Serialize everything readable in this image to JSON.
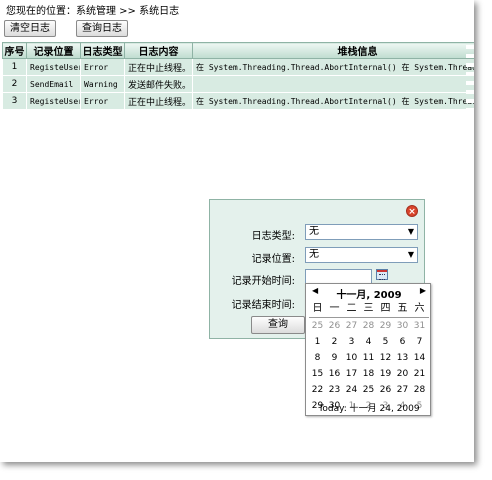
{
  "breadcrumb": "您现在的位置：系统管理 >> 系统日志",
  "toolbar": {
    "clear_label": "清空日志",
    "query_label": "查询日志"
  },
  "table": {
    "headers": [
      "序号",
      "记录位置",
      "日志类型",
      "日志内容",
      "堆栈信息"
    ],
    "rows": [
      [
        "1",
        "RegisteUser",
        "Error",
        "正在中止线程。",
        "在 System.Threading.Thread.AbortInternal() 在 System.Threading.Thre..."
      ],
      [
        "2",
        "SendEmail",
        "Warning",
        "发送邮件失败。",
        ""
      ],
      [
        "3",
        "RegisteUser",
        "Error",
        "正在中止线程。",
        "在 System.Threading.Thread.AbortInternal() 在 System.Threading.Thre..."
      ]
    ]
  },
  "dialog": {
    "log_type_label": "日志类型:",
    "log_type_value": "无",
    "location_label": "记录位置:",
    "location_value": "无",
    "start_label": "记录开始时间:",
    "end_label": "记录结束时间:",
    "query_label": "查询"
  },
  "calendar": {
    "title": "十一月, 2009",
    "weekdays": [
      "日",
      "一",
      "二",
      "三",
      "四",
      "五",
      "六"
    ],
    "weeks": [
      [
        "25",
        "26",
        "27",
        "28",
        "29",
        "30",
        "31"
      ],
      [
        "1",
        "2",
        "3",
        "4",
        "5",
        "6",
        "7"
      ],
      [
        "8",
        "9",
        "10",
        "11",
        "12",
        "13",
        "14"
      ],
      [
        "15",
        "16",
        "17",
        "18",
        "19",
        "20",
        "21"
      ],
      [
        "22",
        "23",
        "24",
        "25",
        "26",
        "27",
        "28"
      ],
      [
        "29",
        "30",
        "1",
        "2",
        "3",
        "4",
        "5"
      ]
    ],
    "today": "Today: 十一月 24, 2009"
  },
  "colors": {
    "header_bg": "#bfdccf",
    "row_bg": "#d8ebe2",
    "dialog_bg": "#e4f1ec"
  }
}
